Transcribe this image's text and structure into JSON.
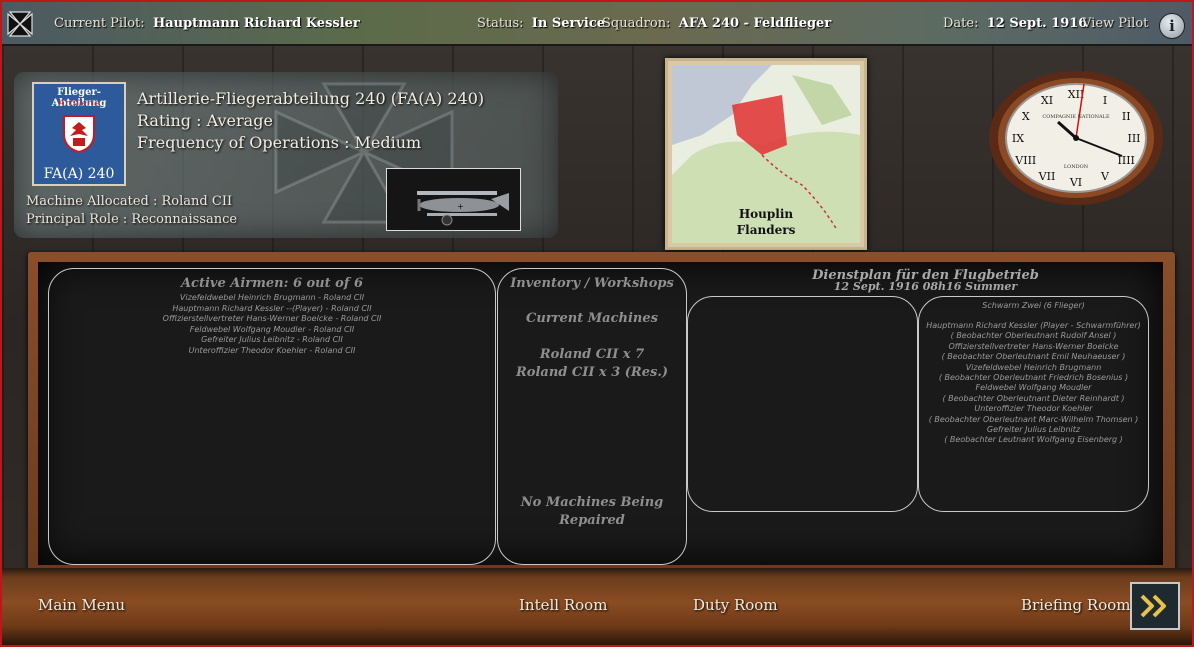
{
  "topbar": {
    "pilot_label": "Current Pilot:",
    "pilot_name": "Hauptmann Richard Kessler",
    "status_label": "Status:",
    "status_value": "In Service",
    "squadron_label": "Squadron:",
    "squadron_value": "AFA 240 - Feldflieger",
    "date_label": "Date:",
    "date_value": "12 Sept. 1916",
    "view_pilot": "View Pilot",
    "info_glyph": "i"
  },
  "squadron": {
    "emblem_line1": "Flieger-Abteilung",
    "emblem_line2": "Artillerie",
    "emblem_line3": "FA(A) 240",
    "name": "Artillerie-Fliegerabteilung 240 (FA(A) 240)",
    "rating": "Rating : Average",
    "frequency": "Frequency of Operations : Medium",
    "machine": "Machine Allocated : Roland CII",
    "role": "Principal Role : Reconnaissance"
  },
  "map": {
    "place": "Houplin",
    "region": "Flanders"
  },
  "clock": {
    "maker_top": "COMPAGNIE NATIONALE",
    "maker_bottom": "LONDON",
    "numerals": [
      "XII",
      "I",
      "II",
      "III",
      "IIII",
      "V",
      "VI",
      "VII",
      "VIII",
      "IX",
      "X",
      "XI"
    ]
  },
  "airmen": {
    "title": "Active Airmen: 6 out of  6",
    "list": [
      "Vizefeldwebel Heinrich Brugmann  - Roland CII",
      "Hauptmann  Richard  Kessler   --(Player) - Roland CII",
      "Offizierstellvertreter Hans-Werner Boelcke  - Roland CII",
      "Feldwebel Wolfgang Moudler   - Roland CII",
      "Gefreiter Julius Leibnitz   - Roland CII",
      "Unteroffizier Theodor Koehler   - Roland CII"
    ]
  },
  "inventory": {
    "title": "Inventory / Workshops",
    "current": "Current Machines",
    "machines": [
      "Roland CII x 7",
      "Roland CII x 3 (Res.)"
    ],
    "repair_line1": "No Machines Being",
    "repair_line2": "Repaired"
  },
  "duty": {
    "title": "Dienstplan für den Flugbetrieb",
    "subtitle": "12 Sept. 1916 08h16 Summer",
    "flight_title": "Schwarm Zwei  (6 Flieger)",
    "flight_list": [
      "Hauptmann Richard Kessler (Player - Schwarmführer)",
      "( Beobachter Oberleutnant Rudolf Ansel )",
      "Offizierstellvertreter Hans-Werner Boelcke",
      "( Beobachter Oberleutnant Emil Neuhaeuser )",
      "Vizefeldwebel Heinrich Brugmann",
      "( Beobachter Oberleutnant Friedrich Bosenius )",
      "Feldwebel Wolfgang Moudler",
      "( Beobachter Oberleutnant Dieter Reinhardt )",
      "Unteroffizier Theodor Koehler",
      "( Beobachter Oberleutnant Marc-Wilhelm Thomsen )",
      "Gefreiter Julius Leibnitz",
      "( Beobachter Leutnant Wolfgang Eisenberg )"
    ]
  },
  "nav": {
    "main_menu": "Main Menu",
    "intell_room": "Intell Room",
    "duty_room": "Duty Room",
    "briefing_room": "Briefing Room",
    "next_glyph": "»"
  },
  "colors": {
    "border": "#c0151a",
    "chalkboard": "#1a1a1a",
    "chalk": "#a7a7a7",
    "map_front": "#e03030"
  }
}
